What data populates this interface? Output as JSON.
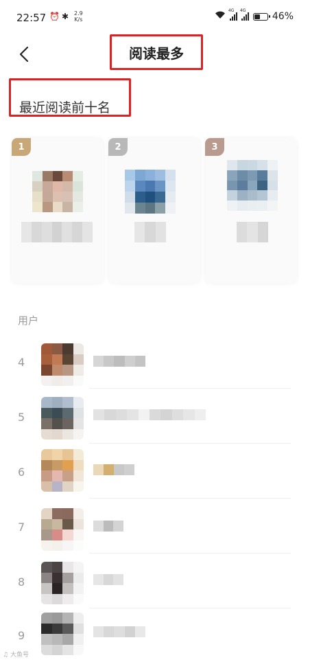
{
  "status_bar": {
    "time": "22:57",
    "speed_value": "2.9",
    "speed_unit": "K/s",
    "signal1_tag": "4G",
    "signal2_tag": "4G",
    "battery_percent": "46%",
    "battery_level": 0.46
  },
  "header": {
    "title": "阅读最多"
  },
  "section": {
    "title": "最近阅读前十名"
  },
  "top3": [
    {
      "rank": "1",
      "badge_color": "#c9a878"
    },
    {
      "rank": "2",
      "badge_color": "#b8b8b8"
    },
    {
      "rank": "3",
      "badge_color": "#b89a8e"
    }
  ],
  "users_label": "用户",
  "rows": [
    {
      "rank": "4"
    },
    {
      "rank": "5"
    },
    {
      "rank": "6"
    },
    {
      "rank": "7"
    },
    {
      "rank": "8"
    },
    {
      "rank": "9"
    }
  ],
  "watermark": "大鱼号"
}
